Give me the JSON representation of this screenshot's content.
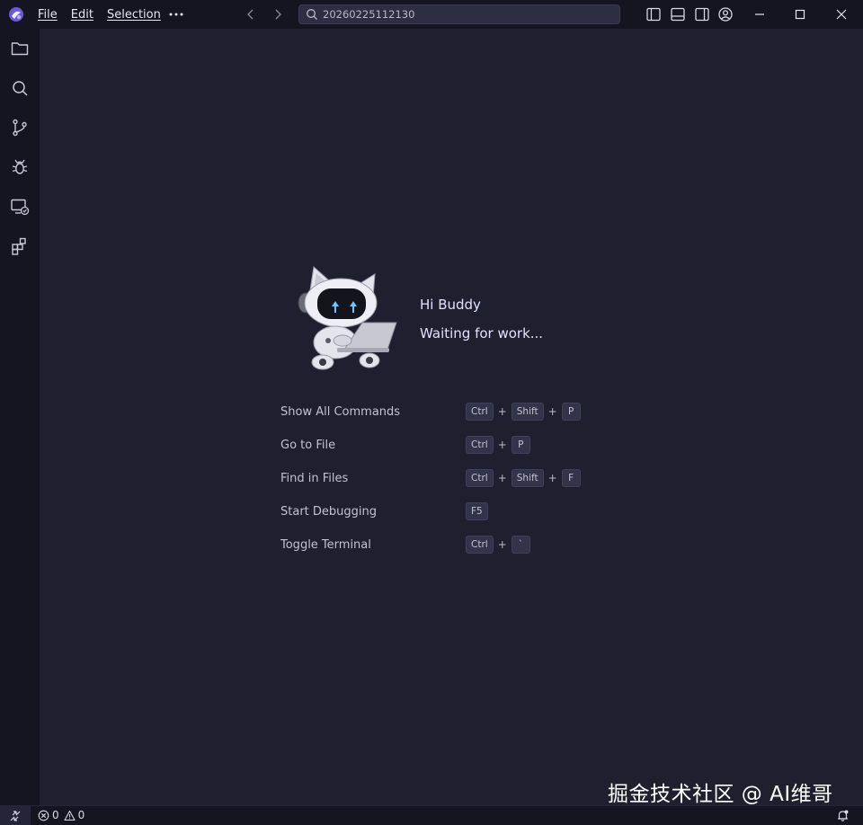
{
  "titlebar": {
    "menu": [
      "File",
      "Edit",
      "Selection"
    ],
    "search_value": "20260225112130"
  },
  "icons": {
    "titlebar": [
      "app-logo-icon",
      "more-icon",
      "arrow-left-icon",
      "arrow-right-icon",
      "search-icon",
      "toggle-primary-sidebar-icon",
      "toggle-panel-icon",
      "toggle-secondary-sidebar-icon",
      "account-icon",
      "minimize-icon",
      "maximize-icon",
      "close-icon"
    ],
    "activitybar": [
      "explorer-icon",
      "search-icon",
      "source-control-icon",
      "run-debug-icon",
      "remote-explorer-icon",
      "extensions-icon"
    ],
    "statusbar": [
      "remote-icon",
      "error-icon",
      "warning-icon",
      "bell-icon"
    ]
  },
  "welcome": {
    "greeting": "Hi Buddy",
    "status": "Waiting for work..."
  },
  "commands": [
    {
      "label": "Show All Commands",
      "keys": [
        "Ctrl",
        "Shift",
        "P"
      ]
    },
    {
      "label": "Go to File",
      "keys": [
        "Ctrl",
        "P"
      ]
    },
    {
      "label": "Find in Files",
      "keys": [
        "Ctrl",
        "Shift",
        "F"
      ]
    },
    {
      "label": "Start Debugging",
      "keys": [
        "F5"
      ]
    },
    {
      "label": "Toggle Terminal",
      "keys": [
        "Ctrl",
        "`"
      ]
    }
  ],
  "statusbar": {
    "errors": "0",
    "warnings": "0"
  },
  "watermark": "掘金技术社区 @ AI维哥",
  "colors": {
    "background": "#1f1f30",
    "chrome": "#151522",
    "accent": "#7b6cf0",
    "greeting": "#dfe3ff"
  }
}
